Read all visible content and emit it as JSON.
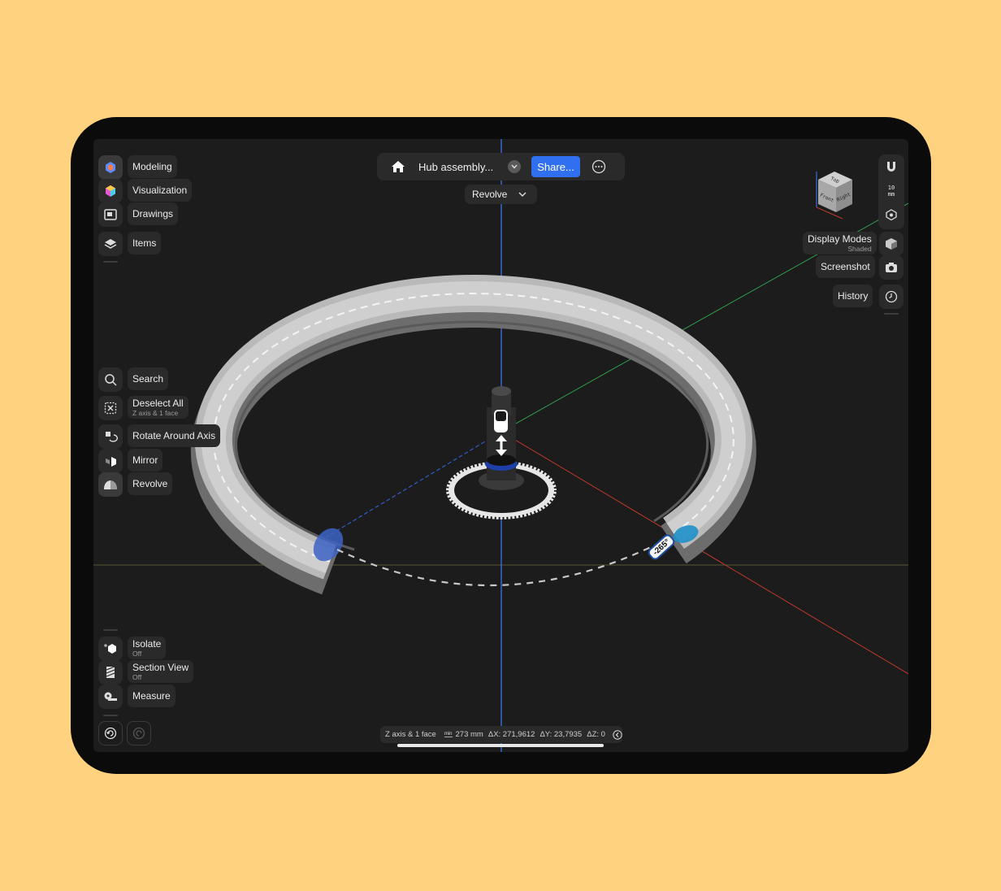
{
  "left_toolbar": {
    "workspaces": [
      {
        "label": "Modeling",
        "icon": "modeling-cube-icon"
      },
      {
        "label": "Visualization",
        "icon": "visualization-icon"
      },
      {
        "label": "Drawings",
        "icon": "drawings-icon"
      }
    ],
    "items_label": "Items",
    "tools": {
      "search": "Search",
      "deselect_all": "Deselect All",
      "deselect_sub": "Z axis & 1 face",
      "rotate_around_axis": "Rotate Around Axis",
      "mirror": "Mirror",
      "revolve": "Revolve"
    },
    "bottom": {
      "isolate": "Isolate",
      "isolate_state": "Off",
      "section_view": "Section View",
      "section_state": "Off",
      "measure": "Measure"
    }
  },
  "top_bar": {
    "document_title": "Hub assembly...",
    "share_label": "Share...",
    "mode_label": "Revolve"
  },
  "right_toolbar": {
    "snap_value": "10",
    "snap_unit": "mm",
    "view_cube": {
      "top": "Top",
      "front": "Front",
      "right": "Right"
    },
    "display_modes": "Display Modes",
    "display_mode_value": "Shaded",
    "screenshot": "Screenshot",
    "history": "History"
  },
  "viewport": {
    "angle_value": "-265°"
  },
  "status_bar": {
    "selection": "Z axis & 1 face",
    "unit_chip": "min",
    "distance": "273 mm",
    "dx": "ΔX: 271,9612",
    "dy": "ΔY: 23,7935",
    "dz": "ΔZ: 0"
  },
  "colors": {
    "background": "#FFD27F",
    "accent": "#2f6ff0",
    "axis_x": "#c0392b",
    "axis_y": "#2e9e4a",
    "axis_z": "#3a7bff"
  }
}
